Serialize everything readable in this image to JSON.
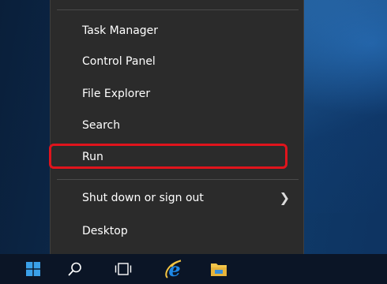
{
  "context_menu": {
    "items": [
      {
        "label": "Task Manager"
      },
      {
        "label": "Control Panel"
      },
      {
        "label": "File Explorer"
      },
      {
        "label": "Search"
      },
      {
        "label": "Run"
      },
      {
        "label": "Shut down or sign out",
        "submenu_icon": "chevron-right-icon"
      },
      {
        "label": "Desktop"
      }
    ],
    "highlighted_item": "Run",
    "highlight_color": "#e0141c"
  },
  "taskbar": {
    "buttons": [
      {
        "icon": "windows-start-icon"
      },
      {
        "icon": "search-icon"
      },
      {
        "icon": "task-view-icon"
      },
      {
        "icon": "internet-explorer-icon"
      },
      {
        "icon": "file-explorer-folder-icon"
      }
    ]
  },
  "colors": {
    "menu_background": "#2b2b2b",
    "taskbar_background": "#0b1526",
    "start_icon": "#3aa0e8",
    "ie_icon": "#1e88e5",
    "folder_icon": "#f2c54a"
  }
}
